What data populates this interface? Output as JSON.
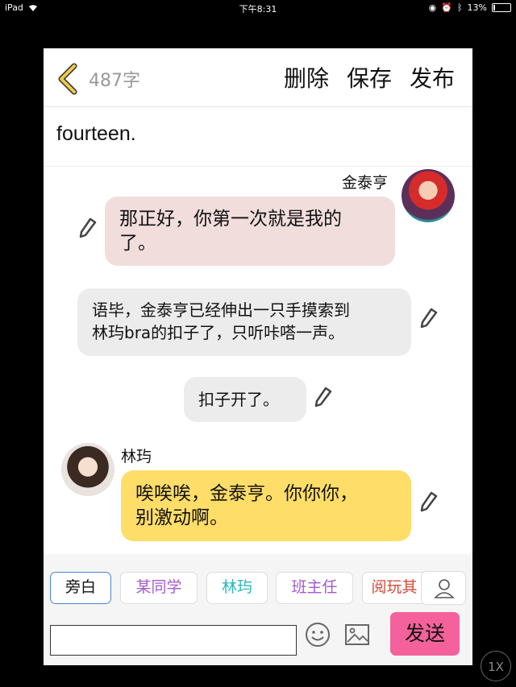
{
  "status_bar": {
    "device": "iPad",
    "time": "下午8:31",
    "battery": "13%",
    "battery_level": 0.13
  },
  "header": {
    "word_count": "487字",
    "delete_label": "删除",
    "save_label": "保存",
    "publish_label": "发布"
  },
  "chapter_title": "fourteen.",
  "messages": [
    {
      "speaker": "金泰亨",
      "text_lines": [
        "那正好，你第一次就是我的",
        "了。"
      ]
    },
    {
      "text_lines": [
        "语毕，金泰亨已经伸出一只手摸索到",
        "林玙bra的扣子了，只听咔嗒一声。"
      ]
    },
    {
      "text_lines": [
        "扣子开了。"
      ]
    },
    {
      "speaker": "林玙",
      "text_lines": [
        "唉唉唉，金泰亨。你你你，",
        "别激动啊。"
      ]
    }
  ],
  "toolbar": {
    "roles": [
      "旁白",
      "某同学",
      "林玙",
      "班主任",
      "阅玩其"
    ],
    "role_colors": [
      "#111111",
      "#a25ad1",
      "#2ab6bb",
      "#a25ad1",
      "#d84a3a"
    ],
    "send_label": "发送",
    "input_value": ""
  },
  "zoom_label": "1X",
  "colors": {
    "accent_back": "#f0c94a",
    "send": "#f5619b",
    "bubble_pink": "#f2dddd",
    "bubble_yellow": "#fedd68"
  }
}
